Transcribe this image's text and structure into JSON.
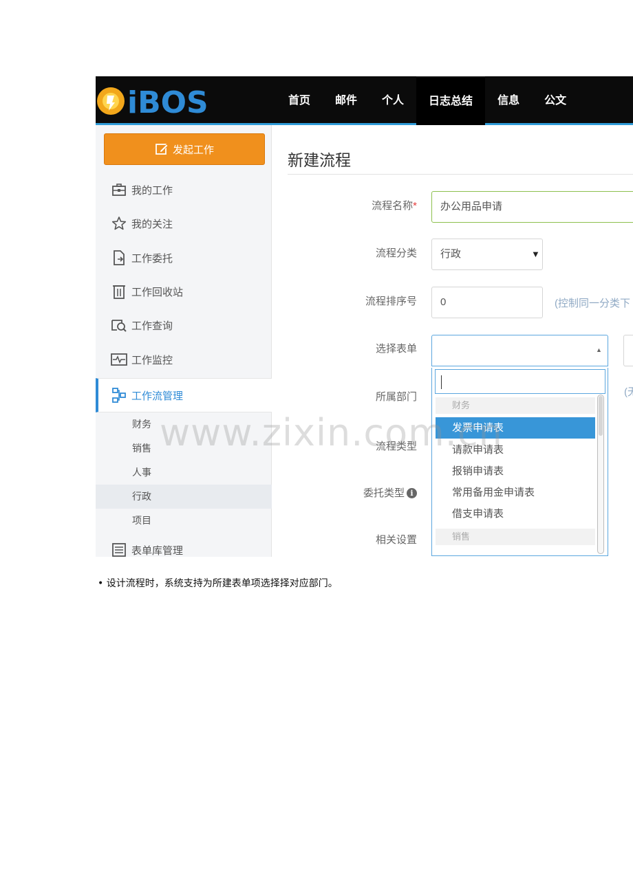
{
  "logo": {
    "text": "iBOS"
  },
  "nav": {
    "items": [
      {
        "label": "首页"
      },
      {
        "label": "邮件"
      },
      {
        "label": "个人"
      },
      {
        "label": "日志总结"
      },
      {
        "label": "信息"
      },
      {
        "label": "公文"
      }
    ]
  },
  "sidebar": {
    "start_button": "发起工作",
    "items": [
      {
        "label": "我的工作",
        "icon": "briefcase-icon"
      },
      {
        "label": "我的关注",
        "icon": "star-icon"
      },
      {
        "label": "工作委托",
        "icon": "document-export-icon"
      },
      {
        "label": "工作回收站",
        "icon": "trash-icon"
      },
      {
        "label": "工作查询",
        "icon": "search-doc-icon"
      },
      {
        "label": "工作监控",
        "icon": "monitor-icon"
      },
      {
        "label": "工作流管理",
        "icon": "flow-icon"
      },
      {
        "label": "表单库管理",
        "icon": "form-list-icon"
      }
    ],
    "sub_items": [
      {
        "label": "财务"
      },
      {
        "label": "销售"
      },
      {
        "label": "人事"
      },
      {
        "label": "行政"
      },
      {
        "label": "项目"
      }
    ]
  },
  "main": {
    "title": "新建流程",
    "fields": {
      "name": {
        "label": "流程名称",
        "required_mark": "*",
        "value": "办公用品申请"
      },
      "category": {
        "label": "流程分类",
        "value": "行政"
      },
      "order": {
        "label": "流程排序号",
        "value": "0",
        "hint": "(控制同一分类下"
      },
      "form": {
        "label": "选择表单"
      },
      "dept": {
        "label": "所属部门",
        "hint": "(无"
      },
      "type": {
        "label": "流程类型"
      },
      "delegate": {
        "label": "委托类型",
        "info_icon": "i"
      },
      "settings": {
        "label": "相关设置"
      }
    },
    "dropdown": {
      "search_value": "",
      "groups": [
        {
          "label": "财务"
        },
        {
          "label": "销售"
        }
      ],
      "options": [
        {
          "label": "发票申请表",
          "selected": true
        },
        {
          "label": "请款申请表",
          "selected": false
        },
        {
          "label": "报销申请表",
          "selected": false
        },
        {
          "label": "常用备用金申请表",
          "selected": false
        },
        {
          "label": "借支申请表",
          "selected": false
        }
      ]
    }
  },
  "watermark": "www.zixin.com.cn",
  "caption": "• 设计流程时，系统支持为所建表单项选择择对应部门。"
}
